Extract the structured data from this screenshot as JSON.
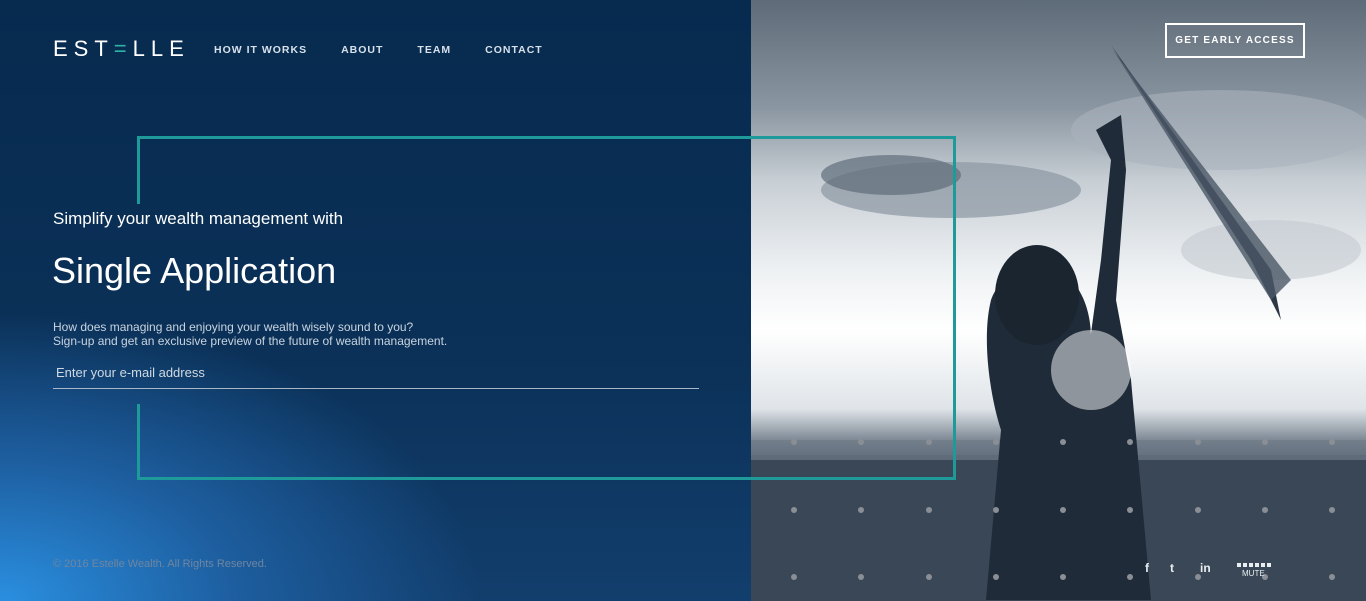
{
  "brand": {
    "logo_prefix": "EST",
    "logo_accent": "=",
    "logo_suffix": "LLE"
  },
  "nav": {
    "items": [
      {
        "label": "HOW IT WORKS"
      },
      {
        "label": "ABOUT"
      },
      {
        "label": "TEAM"
      },
      {
        "label": "CONTACT"
      }
    ]
  },
  "cta": {
    "label": "GET EARLY ACCESS"
  },
  "hero": {
    "subtitle": "Simplify your wealth management with",
    "title": "Single Application",
    "description_line1": "How does managing and enjoying your wealth wisely sound to you?",
    "description_line2": "Sign-up and get an exclusive preview of the future of wealth management.",
    "email_placeholder": "Enter your e-mail address"
  },
  "footer": {
    "copyright": "© 2016 Estelle Wealth. All Rights Reserved."
  },
  "social": {
    "facebook": "f",
    "twitter": "t",
    "linkedin": "in",
    "mute_label": "MUTE"
  },
  "colors": {
    "accent": "#1f9a9a",
    "background": "#0a2a4d",
    "text": "#ffffff"
  }
}
